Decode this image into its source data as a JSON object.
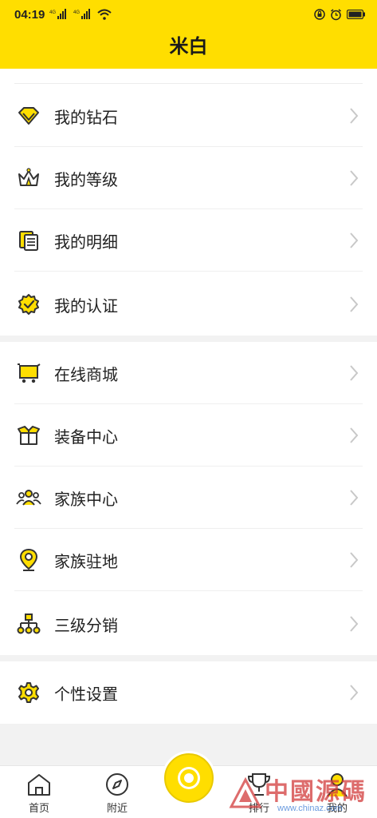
{
  "status_bar": {
    "time": "04:19",
    "signal_1": "4G",
    "signal_2": "4G",
    "icons": [
      "signal-icon",
      "wifi-icon",
      "lock-icon",
      "alarm-icon",
      "battery-icon"
    ]
  },
  "header": {
    "title": "米白"
  },
  "menu_groups": [
    {
      "items": [
        {
          "label": "我的钻石",
          "icon": "diamond-icon"
        },
        {
          "label": "我的等级",
          "icon": "crown-icon"
        },
        {
          "label": "我的明细",
          "icon": "document-icon"
        },
        {
          "label": "我的认证",
          "icon": "verified-badge-icon"
        }
      ]
    },
    {
      "items": [
        {
          "label": "在线商城",
          "icon": "cart-icon"
        },
        {
          "label": "装备中心",
          "icon": "box-icon"
        },
        {
          "label": "家族中心",
          "icon": "group-icon"
        },
        {
          "label": "家族驻地",
          "icon": "location-pin-icon"
        },
        {
          "label": "三级分销",
          "icon": "hierarchy-icon"
        }
      ]
    },
    {
      "items": [
        {
          "label": "个性设置",
          "icon": "gear-icon"
        }
      ]
    }
  ],
  "tabbar": {
    "tabs": [
      {
        "label": "首页",
        "icon": "home-icon"
      },
      {
        "label": "附近",
        "icon": "compass-icon"
      },
      {
        "label": "排行",
        "icon": "trophy-icon"
      },
      {
        "label": "我的",
        "icon": "profile-icon"
      }
    ]
  },
  "watermark": {
    "text": "中國源碼",
    "url": "www.chinaz.com"
  },
  "colors": {
    "accent": "#ffde00",
    "icon_outline": "#333333",
    "chevron": "#c8c8c8"
  }
}
